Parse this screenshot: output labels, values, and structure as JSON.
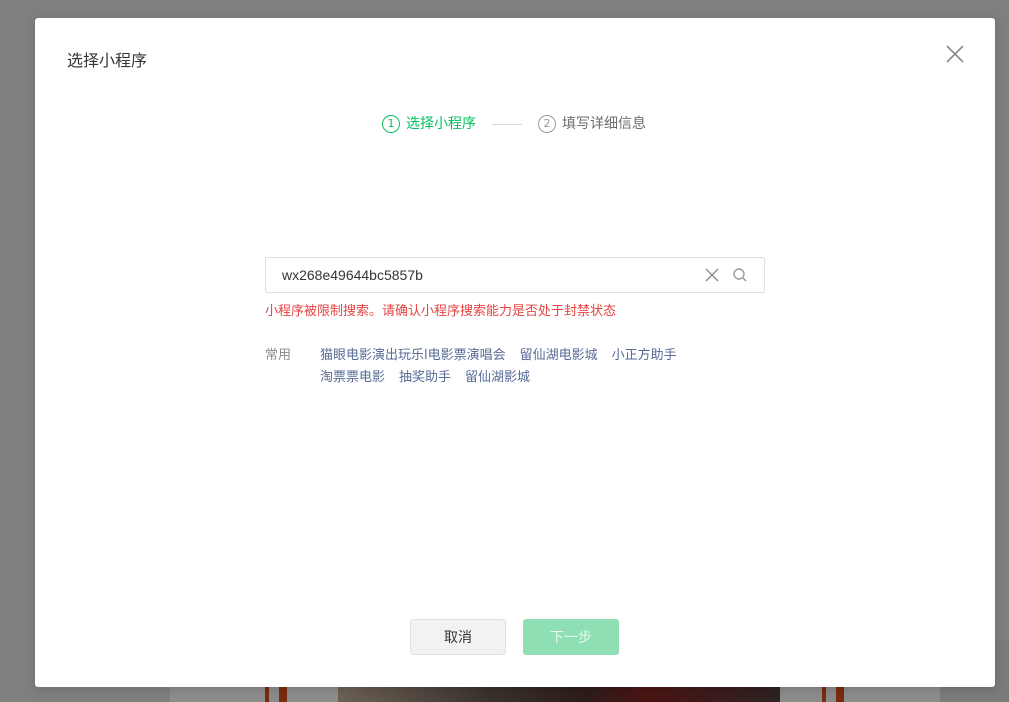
{
  "dialog": {
    "title": "选择小程序"
  },
  "steps": [
    {
      "number": "1",
      "label": "选择小程序",
      "state": "active"
    },
    {
      "number": "2",
      "label": "填写详细信息",
      "state": "inactive"
    }
  ],
  "search": {
    "value": "wx268e49644bc5857b",
    "placeholder": ""
  },
  "error": {
    "message": "小程序被限制搜索。请确认小程序搜索能力是否处于封禁状态"
  },
  "common": {
    "label": "常用",
    "items": [
      "猫眼电影演出玩乐l电影票演唱会",
      "留仙湖电影城",
      "小正方助手",
      "淘票票电影",
      "抽奖助手",
      "留仙湖影城"
    ]
  },
  "footer": {
    "cancel_label": "取消",
    "next_label": "下一步"
  },
  "colors": {
    "accent": "#07c160",
    "error": "#e64340",
    "link": "#576b95",
    "next_disabled": "#8ee0b4"
  },
  "icons": {
    "close": "close-icon",
    "clear": "clear-icon",
    "search": "search-icon"
  }
}
